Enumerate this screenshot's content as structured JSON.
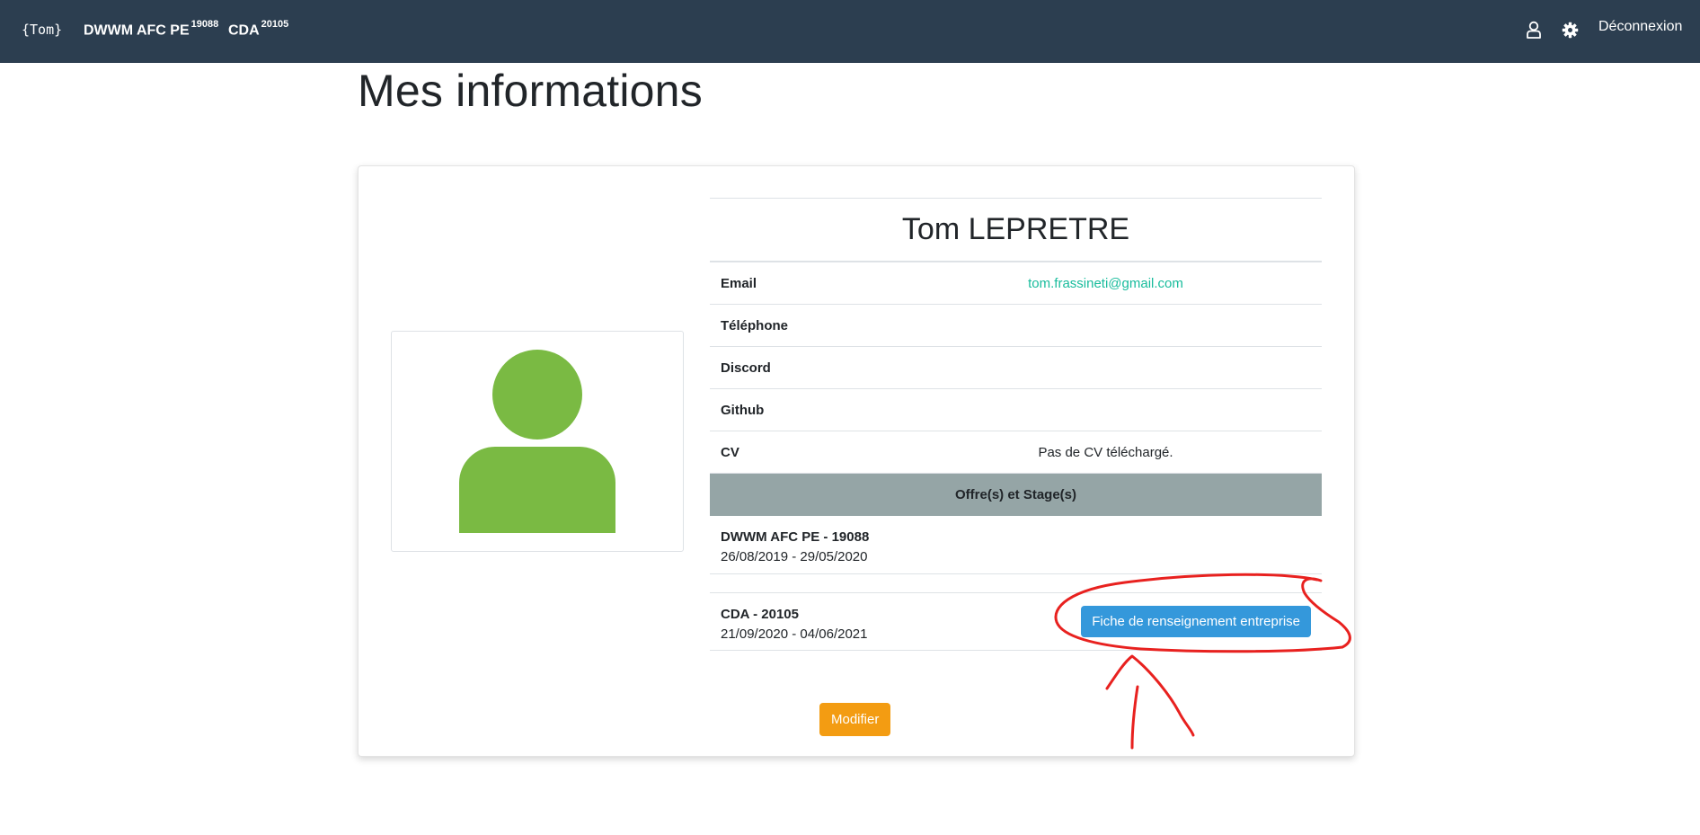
{
  "navbar": {
    "brand": "{Tom}",
    "links": [
      {
        "label": "DWWM AFC PE",
        "sup": "19088"
      },
      {
        "label": "CDA",
        "sup": "20105"
      }
    ],
    "icons": [
      "user-icon",
      "gear-icon"
    ],
    "logout_label": "Déconnexion",
    "background": "#2c3e50"
  },
  "page": {
    "title": "Mes informations"
  },
  "profile": {
    "name": "Tom LEPRETRE",
    "avatar_color": "#7aba43",
    "fields": [
      {
        "label": "Email",
        "value": "tom.frassineti@gmail.com"
      },
      {
        "label": "Téléphone",
        "value": ""
      },
      {
        "label": "Discord",
        "value": ""
      },
      {
        "label": "Github",
        "value": ""
      },
      {
        "label": "CV",
        "value": "Pas de CV téléchargé."
      }
    ],
    "section_header": "Offre(s) et Stage(s)",
    "offers": [
      {
        "title": "DWWM AFC PE - 19088",
        "dates": "26/08/2019 - 29/05/2020"
      },
      {
        "title": "CDA - 20105",
        "dates": "21/09/2020 - 04/06/2021",
        "button_label": "Fiche de renseignement entreprise"
      }
    ],
    "edit_button_label": "Modifier"
  },
  "colors": {
    "accent_link": "#18bc9c",
    "primary_button": "#3498db",
    "warning_button": "#f39c12",
    "section_header_bg": "#95a5a6",
    "annotation": "#e8211f"
  }
}
